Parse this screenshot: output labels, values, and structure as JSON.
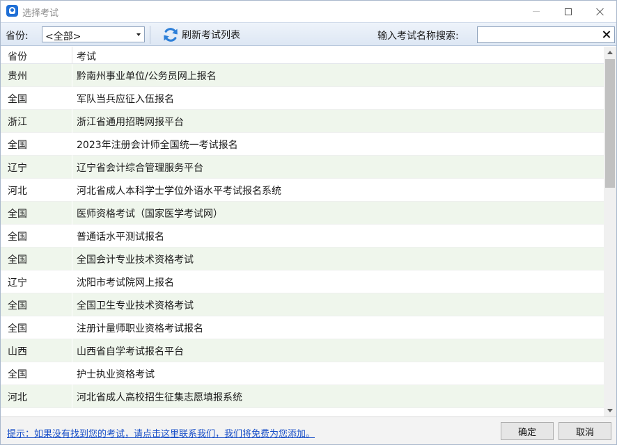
{
  "window": {
    "title": "选择考试"
  },
  "toolbar": {
    "province_label": "省份:",
    "province_value": "<全部>",
    "refresh_label": "刷新考试列表",
    "search_label": "输入考试名称搜索:",
    "search_value": ""
  },
  "table": {
    "columns": [
      "省份",
      "考试"
    ],
    "rows": [
      {
        "province": "贵州",
        "exam": "黔南州事业单位/公务员网上报名"
      },
      {
        "province": "全国",
        "exam": "军队当兵应征入伍报名"
      },
      {
        "province": "浙江",
        "exam": "浙江省通用招聘网报平台"
      },
      {
        "province": "全国",
        "exam": "2023年注册会计师全国统一考试报名"
      },
      {
        "province": "辽宁",
        "exam": "辽宁省会计综合管理服务平台"
      },
      {
        "province": "河北",
        "exam": "河北省成人本科学士学位外语水平考试报名系统"
      },
      {
        "province": "全国",
        "exam": "医师资格考试（国家医学考试网）"
      },
      {
        "province": "全国",
        "exam": "普通话水平测试报名"
      },
      {
        "province": "全国",
        "exam": "全国会计专业技术资格考试"
      },
      {
        "province": "辽宁",
        "exam": "沈阳市考试院网上报名"
      },
      {
        "province": "全国",
        "exam": "全国卫生专业技术资格考试"
      },
      {
        "province": "全国",
        "exam": "注册计量师职业资格考试报名"
      },
      {
        "province": "山西",
        "exam": "山西省自学考试报名平台"
      },
      {
        "province": "全国",
        "exam": "护士执业资格考试"
      },
      {
        "province": "河北",
        "exam": "河北省成人高校招生征集志愿填报系统"
      }
    ]
  },
  "footer": {
    "hint": "提示：如果没有找到您的考试，请点击这里联系我们，我们将免费为您添加。",
    "ok_label": "确定",
    "cancel_label": "取消"
  },
  "colors": {
    "row_alt": "#eff6ec",
    "toolbar_top": "#eef3fa",
    "toolbar_bottom": "#dde7f4",
    "hint_link": "#1a50c8",
    "refresh_icon": "#2d7fd8"
  }
}
